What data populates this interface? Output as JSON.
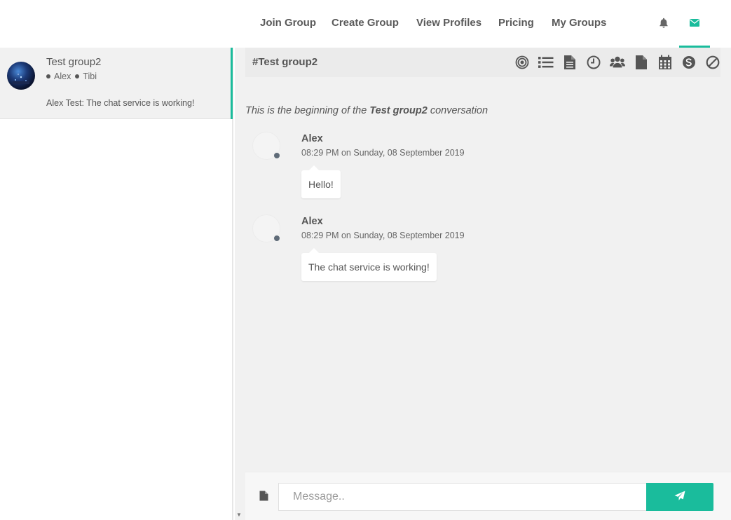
{
  "nav": {
    "links": [
      "Join Group",
      "Create Group",
      "View Profiles",
      "Pricing",
      "My Groups"
    ],
    "icons": [
      "bell-icon",
      "envelope-icon"
    ],
    "accent_color": "#1abc9c"
  },
  "sidebar": {
    "groups": [
      {
        "name": "Test group2",
        "members": [
          "Alex",
          "Tibi"
        ],
        "preview": "Alex Test: The chat service is working!"
      }
    ]
  },
  "chat": {
    "title": "#Test group2",
    "header_icons": [
      "target-icon",
      "list-icon",
      "document-icon",
      "clock-icon",
      "users-icon",
      "file-icon",
      "calendar-icon",
      "skype-icon",
      "block-icon"
    ],
    "intro_prefix": "This is the beginning of the ",
    "intro_group": "Test group2",
    "intro_suffix": " conversation",
    "messages": [
      {
        "author": "Alex",
        "time": "08:29 PM on Sunday, 08 September 2019",
        "text": "Hello!"
      },
      {
        "author": "Alex",
        "time": "08:29 PM on Sunday, 08 September 2019",
        "text": "The chat service is working!"
      }
    ]
  },
  "composer": {
    "placeholder": "Message..",
    "value": ""
  }
}
